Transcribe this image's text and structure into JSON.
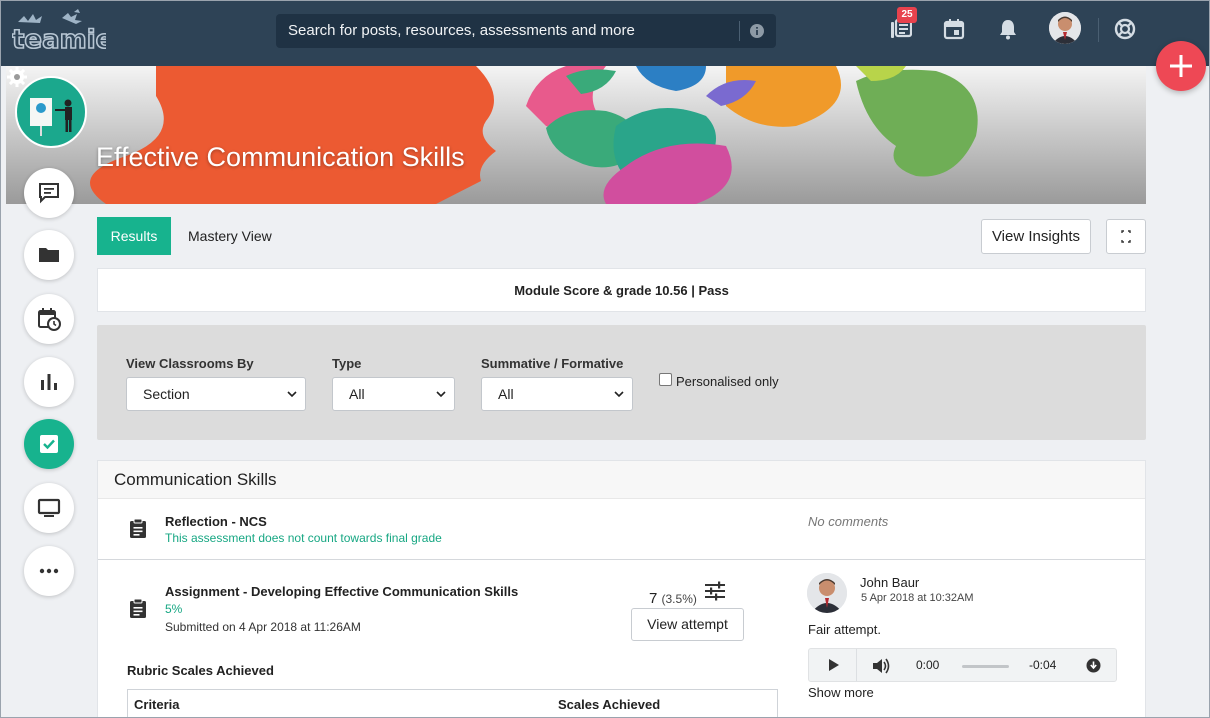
{
  "header": {
    "logo_text": "teamie",
    "search_placeholder": "Search for posts, resources, assessments and more",
    "notification_badge": "25",
    "icons": [
      "logo-mascot",
      "info-icon",
      "library-icon",
      "calendar-icon",
      "bell-icon",
      "user-avatar",
      "help-lifebuoy-icon",
      "plus-icon"
    ]
  },
  "course": {
    "title": "Effective Communication Skills"
  },
  "rail": {
    "icons": [
      "chat-icon",
      "folder-icon",
      "calendar-clock-icon",
      "bar-chart-icon",
      "checkbox-icon",
      "monitor-icon",
      "more-icon"
    ],
    "active": "checkbox-icon"
  },
  "tabs": {
    "results": "Results",
    "mastery": "Mastery View"
  },
  "actions": {
    "insights": "View Insights"
  },
  "module_score": "Module Score & grade 10.56 | Pass",
  "filters": {
    "classrooms_label": "View Classrooms By",
    "classrooms_value": "Section",
    "type_label": "Type",
    "type_value": "All",
    "summative_label": "Summative / Formative",
    "summative_value": "All",
    "personalised_label": "Personalised only"
  },
  "results": {
    "section_title": "Communication Skills",
    "items": [
      {
        "title": "Reflection - NCS",
        "note": "This assessment does not count towards final grade",
        "comment": "No comments"
      },
      {
        "title": "Assignment - Developing Effective Communication Skills",
        "weight": "5%",
        "submitted": "Submitted on 4 Apr 2018 at 11:26AM",
        "score": "7",
        "score_pct": "(3.5%)",
        "attempt_button": "View attempt",
        "commenter": "John Baur",
        "comment_date": "5 Apr 2018 at 10:32AM",
        "comment": "Fair attempt.",
        "audio_elapsed": "0:00",
        "audio_remaining": "-0:04",
        "show_more": "Show more"
      }
    ],
    "rubric_title": "Rubric Scales Achieved",
    "rubric_headers": [
      "Criteria",
      "Scales Achieved"
    ]
  },
  "colors": {
    "topbar": "#2e4356",
    "accent_green": "#17b38e",
    "fab_red": "#ee4855"
  }
}
